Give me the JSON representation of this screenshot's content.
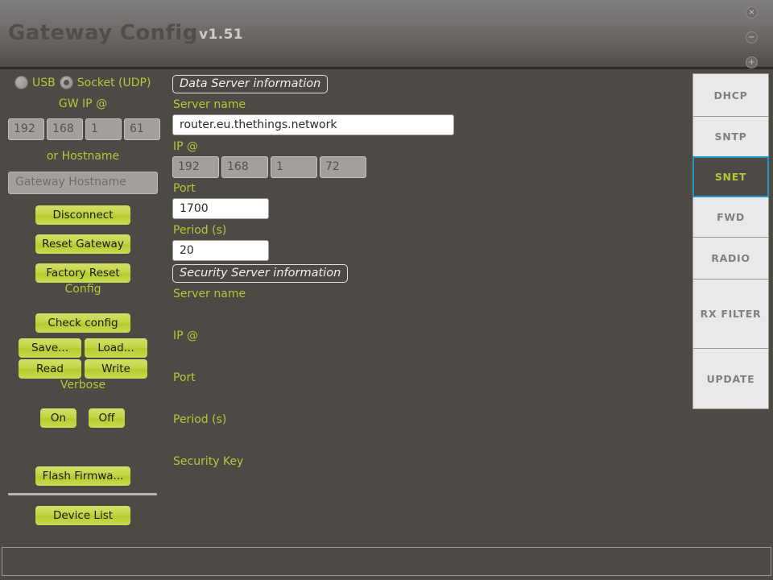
{
  "window": {
    "title": "Gateway Config",
    "version": "v1.51",
    "controls": [
      {
        "name": "close",
        "glyph": "×"
      },
      {
        "name": "minimize",
        "glyph": "−"
      },
      {
        "name": "maximize",
        "glyph": "+"
      }
    ]
  },
  "sidebar": {
    "connection_modes": [
      {
        "label": "USB",
        "selected": false
      },
      {
        "label": "Socket (UDP)",
        "selected": true
      }
    ],
    "gw_ip_caption": "GW IP @",
    "gw_ip_octets": [
      "192",
      "168",
      "1",
      "61"
    ],
    "or_hostname_caption": "or Hostname",
    "hostname_placeholder": "Gateway Hostname",
    "hostname_value": "",
    "disconnect_label": "Disconnect",
    "reset_gateway_label": "Reset Gateway",
    "factory_reset_label": "Factory Reset",
    "config_caption": "Config",
    "check_config_label": "Check config",
    "save_label": "Save...",
    "load_label": "Load...",
    "read_label": "Read",
    "write_label": "Write",
    "verbose_caption": "Verbose",
    "verbose_on_label": "On",
    "verbose_off_label": "Off",
    "flash_firmware_label": "Flash Firmwa...",
    "device_list_label": "Device List"
  },
  "main": {
    "data_server": {
      "group_title": "Data Server information",
      "server_name_label": "Server name",
      "server_name_value": "router.eu.thethings.network",
      "ip_label": "IP @",
      "ip_octets": [
        "192",
        "168",
        "1",
        "72"
      ],
      "port_label": "Port",
      "port_value": "1700",
      "period_label": "Period (s)",
      "period_value": "20"
    },
    "security_server": {
      "group_title": "Security Server information",
      "server_name_label": "Server name",
      "server_name_value": "",
      "ip_label": "IP @",
      "port_label": "Port",
      "period_label": "Period (s)",
      "security_key_label": "Security Key"
    }
  },
  "tabs": [
    {
      "label": "DHCP",
      "active": false
    },
    {
      "label": "SNTP",
      "active": false
    },
    {
      "label": "SNET",
      "active": true
    },
    {
      "label": "FWD",
      "active": false
    },
    {
      "label": "RADIO",
      "active": false
    },
    {
      "label": "RX FILTER",
      "active": false
    },
    {
      "label": "UPDATE",
      "active": false
    }
  ],
  "statusbar": {
    "text": ""
  },
  "colors": {
    "accent_green": "#b7c53a",
    "button_green": "#c3d445",
    "active_tab_border": "#2196c4",
    "window_bg": "#4d4a46"
  }
}
